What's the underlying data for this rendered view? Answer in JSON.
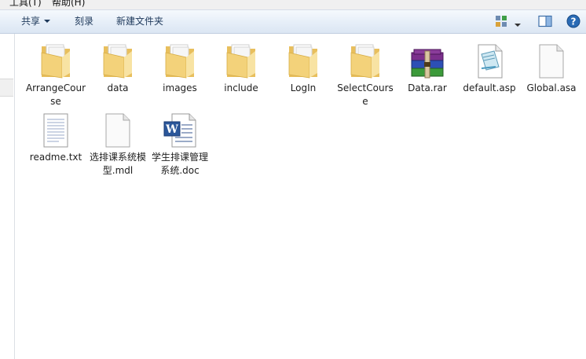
{
  "menu": {
    "tools_label": "工具(T)",
    "help_label": "帮助(H)"
  },
  "toolbar": {
    "share_label": "共享",
    "burn_label": "刻录",
    "new_folder_label": "新建文件夹"
  },
  "files": [
    {
      "name": "ArrangeCourse",
      "icon": "folder-icon"
    },
    {
      "name": "data",
      "icon": "folder-icon"
    },
    {
      "name": "images",
      "icon": "folder-icon"
    },
    {
      "name": "include",
      "icon": "folder-icon"
    },
    {
      "name": "LogIn",
      "icon": "folder-icon"
    },
    {
      "name": "SelectCourse",
      "icon": "folder-icon"
    },
    {
      "name": "Data.rar",
      "icon": "rar-archive-icon"
    },
    {
      "name": "default.asp",
      "icon": "asp-file-icon"
    },
    {
      "name": "Global.asa",
      "icon": "blank-file-icon"
    },
    {
      "name": "readme.txt",
      "icon": "text-file-icon"
    },
    {
      "name": "选排课系统模型.mdl",
      "icon": "blank-file-icon"
    },
    {
      "name": "学生排课管理系统.doc",
      "icon": "word-document-icon"
    }
  ],
  "colors": {
    "toolbar_text": "#1e395b",
    "folder": "#f3d27a",
    "help": "#2a6bb5"
  }
}
